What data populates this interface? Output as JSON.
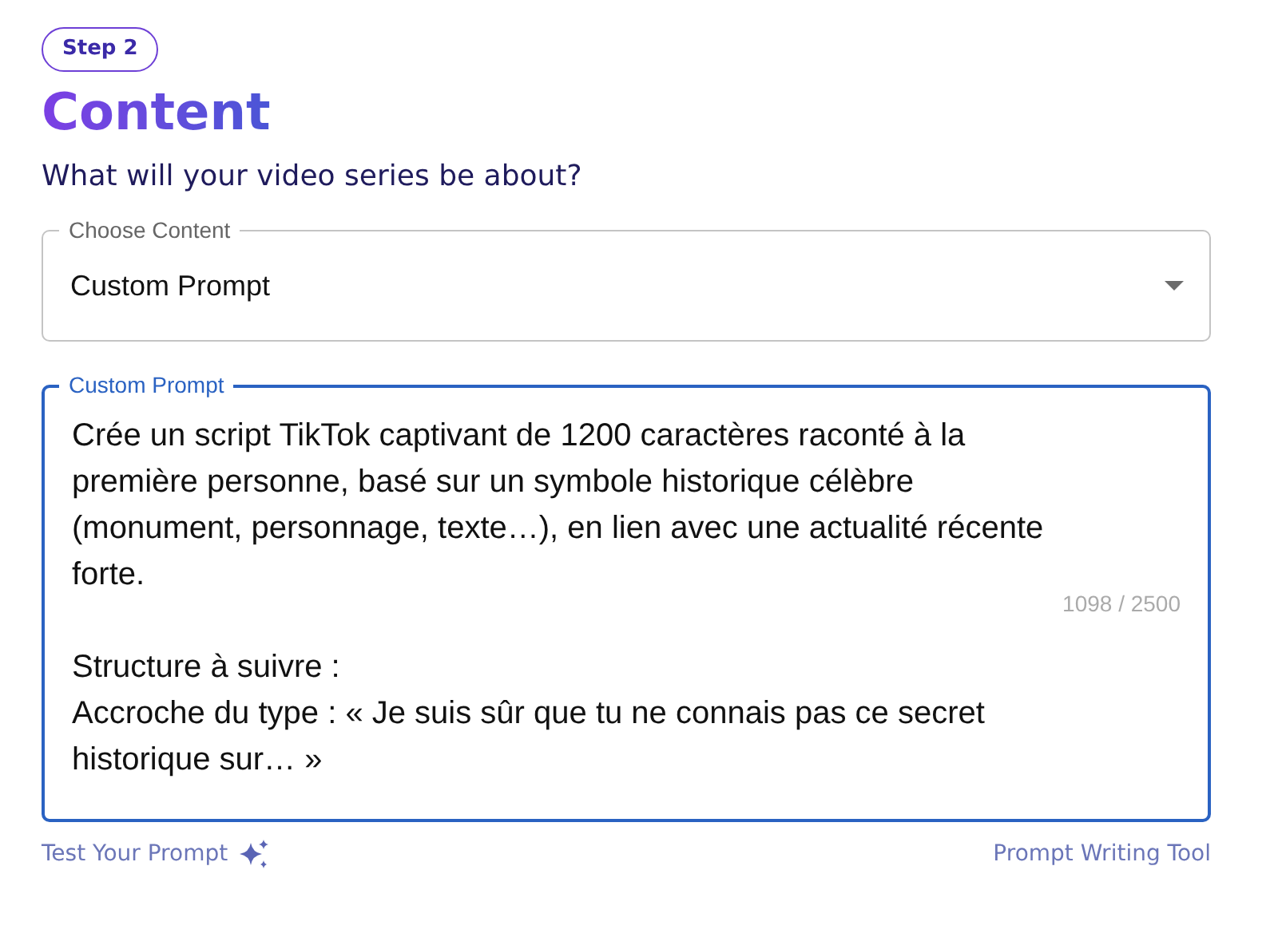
{
  "step_badge": "Step 2",
  "title": "Content",
  "subtitle": "What will your video series be about?",
  "content_select": {
    "label": "Choose Content",
    "value": "Custom Prompt"
  },
  "prompt_field": {
    "label": "Custom Prompt",
    "focused": true,
    "value": "Crée un script TikTok captivant de 1200 caractères raconté à la première personne, basé sur un symbole historique célèbre (monument, personnage, texte…), en lien avec une actualité récente forte.\n\nStructure à suivre :\nAccroche du type : « Je suis sûr que tu ne connais pas ce secret historique sur… »",
    "counter": "1098 / 2500"
  },
  "links": [
    {
      "label": "Test Your Prompt",
      "kind": "sparkle"
    },
    {
      "label": "Prompt Writing Tool",
      "kind": "plain"
    }
  ]
}
